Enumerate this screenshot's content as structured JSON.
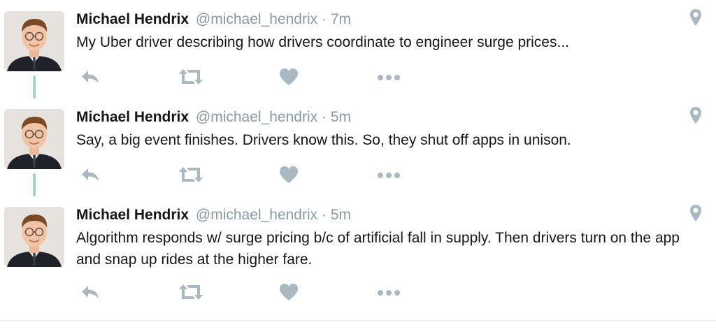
{
  "tweets": [
    {
      "author_name": "Michael Hendrix",
      "handle": "@michael_hendrix",
      "separator": "·",
      "time": "7m",
      "text": "My Uber driver describing how drivers coordinate to engineer surge prices..."
    },
    {
      "author_name": "Michael Hendrix",
      "handle": "@michael_hendrix",
      "separator": "·",
      "time": "5m",
      "text": "Say, a big event finishes. Drivers know this. So, they shut off apps in unison."
    },
    {
      "author_name": "Michael Hendrix",
      "handle": "@michael_hendrix",
      "separator": "·",
      "time": "5m",
      "text": "Algorithm responds w/ surge pricing b/c of artificial fall in supply. Then drivers turn on the app and snap up rides at the higher fare."
    }
  ],
  "icons": {
    "reply": "reply-icon",
    "retweet": "retweet-icon",
    "like": "heart-icon",
    "more": "more-dots-icon",
    "location": "location-pin-icon"
  },
  "colors": {
    "icon_gray": "#aab8c2",
    "meta_gray": "#8899a6",
    "thread_line": "#a6d4c4",
    "text": "#14171a"
  }
}
